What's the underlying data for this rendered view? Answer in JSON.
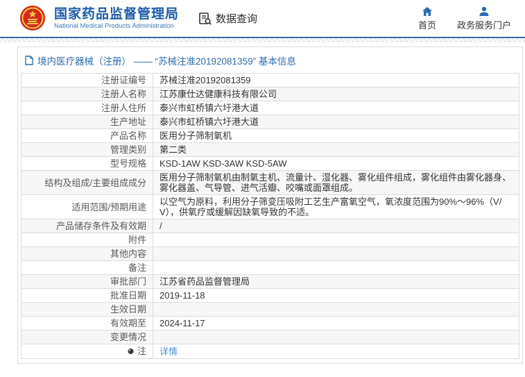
{
  "header": {
    "agency_name": "国家药品监督管理局",
    "agency_name_en": "National Medical Products Administration",
    "data_query_label": "数据查询",
    "nav": [
      {
        "label": "首页",
        "icon": "home-icon"
      },
      {
        "label": "政务服务门户",
        "icon": "user-icon"
      }
    ]
  },
  "page": {
    "title": "境内医疗器械（注册） ——  “苏械注准20192081359”  基本信息",
    "title_icon": "document-icon"
  },
  "table": {
    "rows": [
      {
        "label": "注册证编号",
        "value": "苏械注准20192081359"
      },
      {
        "label": "注册人名称",
        "value": "江苏康仕达健康科技有限公司"
      },
      {
        "label": "注册人住所",
        "value": "泰兴市虹桥镇六圩港大道"
      },
      {
        "label": "生产地址",
        "value": "泰兴市虹桥镇六圩港大道"
      },
      {
        "label": "产品名称",
        "value": "医用分子筛制氧机"
      },
      {
        "label": "管理类别",
        "value": "第二类"
      },
      {
        "label": "型号规格",
        "value": "KSD-1AW KSD-3AW KSD-5AW"
      },
      {
        "label": "结构及组成/主要组成成分",
        "value": "医用分子筛制氧机由制氧主机、流量计、湿化器、雾化组件组成，雾化组件由雾化器身、雾化器盖、气导管、进气活瓣、咬嘴或面罩组成。"
      },
      {
        "label": "适用范围/预期用途",
        "value": "以空气为原料，利用分子筛变压吸附工艺生产富氧空气，氧浓度范围为90%～96%（V/V），供氧疗或缓解因缺氧导致的不适。"
      },
      {
        "label": "产品储存条件及有效期",
        "value": "/"
      },
      {
        "label": "附件",
        "value": ""
      },
      {
        "label": "其他内容",
        "value": ""
      },
      {
        "label": "备注",
        "value": ""
      },
      {
        "label": "审批部门",
        "value": "江苏省药品监督管理局"
      },
      {
        "label": "批准日期",
        "value": "2019-11-18"
      },
      {
        "label": "生效日期",
        "value": ""
      },
      {
        "label": "有效期至",
        "value": "2024-11-17"
      },
      {
        "label": "变更情况",
        "value": ""
      },
      {
        "label": "注",
        "value": "详情",
        "value_is_link": true,
        "label_icon": "note-icon"
      }
    ]
  },
  "colors": {
    "header_title_blue": "#1c5caa",
    "header_subtitle_blue": "#3c78b5",
    "header_border_blue": "#2e6da4",
    "nav_icon_blue": "#2a6bb5",
    "page_title_blue": "#2d6daf",
    "link_blue": "#4a90d9",
    "row_alt_bg": "#f7f7f7",
    "table_border": "#dcdcdc",
    "label_text": "#595959",
    "value_text": "#333333",
    "emblem_red": "#d5281e",
    "emblem_gold": "#f3c545"
  }
}
